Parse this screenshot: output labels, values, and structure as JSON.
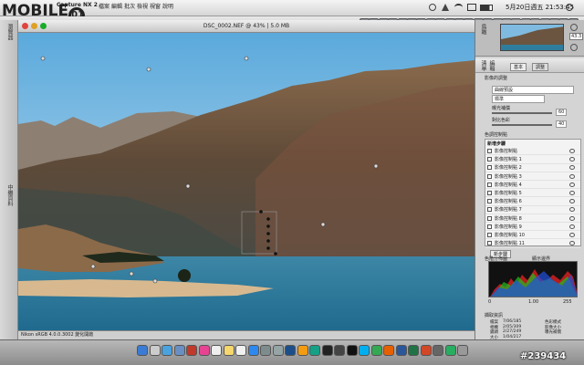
{
  "brand": {
    "logo_text": "MOBILE",
    "logo_badge": "01"
  },
  "menubar": {
    "app": "Capture NX 2",
    "items": [
      "檔案",
      "編輯",
      "批次",
      "檢視",
      "視窗",
      "說明"
    ],
    "clock": "5月20日週五 21:53:45"
  },
  "toolbar": {
    "icons": [
      "select-tool",
      "hand-tool",
      "zoom-tool",
      "rotate-tool",
      "straighten-tool",
      "crop-tool",
      "red-eye-tool",
      "brush-tool",
      "eraser-tool",
      "lasso-tool",
      "marquee-tool",
      "fill-tool",
      "gradient-tool",
      "control-point-tool",
      "color-point-tool",
      "black-point-tool",
      "neutral-point-tool",
      "white-point-tool",
      "red-eye-tool",
      "auto-retouch-tool",
      "batch-tool",
      "info-tool",
      "print-tool"
    ]
  },
  "leftstrip": {
    "top_label": "瀏覽器",
    "bottom_label": "中繼資料"
  },
  "image_window": {
    "title": "DSC_0002.NEF @ 43% | 5.0 MB",
    "status": "Nikon sRGB 4.0.0.3002  變化開啟"
  },
  "right_panel": {
    "zoom_value": "43.3",
    "nav_label": "鳥瞰",
    "side_label": "編輯清單",
    "tabs": [
      "基本",
      "調整"
    ],
    "dropdown_1": "曲線預設",
    "dropdown_2": "標準",
    "slider_1_label": "曝光補償",
    "slider_1_value": "60",
    "slider_2_label": "對比色彩",
    "slider_2_value": "40",
    "section_1": "影像的調整",
    "section_2": "色調控制點",
    "steps_header": "新增步驟",
    "steps": [
      "影像控制點",
      "影像控制點 1",
      "影像控制點 2",
      "影像控制點 3",
      "影像控制點 4",
      "影像控制點 5",
      "影像控制點 6",
      "影像控制點 7",
      "影像控制點 8",
      "影像控制點 9",
      "影像控制點 10",
      "影像控制點 11"
    ],
    "new_step_button": "新步驟",
    "histogram_label": "色階分佈圖",
    "histogram_checkbox": "顯示邊界",
    "histogram_min": "0",
    "histogram_max": "255",
    "histogram_mid": "1.00",
    "info_label": "擷取資訊",
    "info_rows": [
      {
        "k": "檔案",
        "v": "7/06/185"
      },
      {
        "k": "相機",
        "v": "2/05/309"
      },
      {
        "k": "鏡頭",
        "v": "2/27/249"
      },
      {
        "k": "大小",
        "v": "1/04/217"
      }
    ],
    "info_side": [
      "色彩模式",
      "影像大小",
      "曝光補償"
    ]
  },
  "colors": {
    "sky_top": "#6ab3e2",
    "sky_bottom": "#c6e1f0",
    "lake": "#2f7d9e",
    "mountain": "#6b5540",
    "dock_bg": "#9a9a9a"
  },
  "dock": {
    "icons": [
      "finder",
      "launchpad",
      "safari",
      "mail",
      "photo-booth",
      "itunes",
      "calendar",
      "notes",
      "reminders",
      "app-store",
      "system-prefs",
      "preview",
      "photoshop",
      "illustrator",
      "dreamweaver",
      "capture-nx",
      "camera",
      "terminal",
      "skype",
      "chrome",
      "firefox",
      "word",
      "excel",
      "powerpoint",
      "calculator",
      "activity",
      "trash"
    ]
  },
  "watermark": "#239434"
}
